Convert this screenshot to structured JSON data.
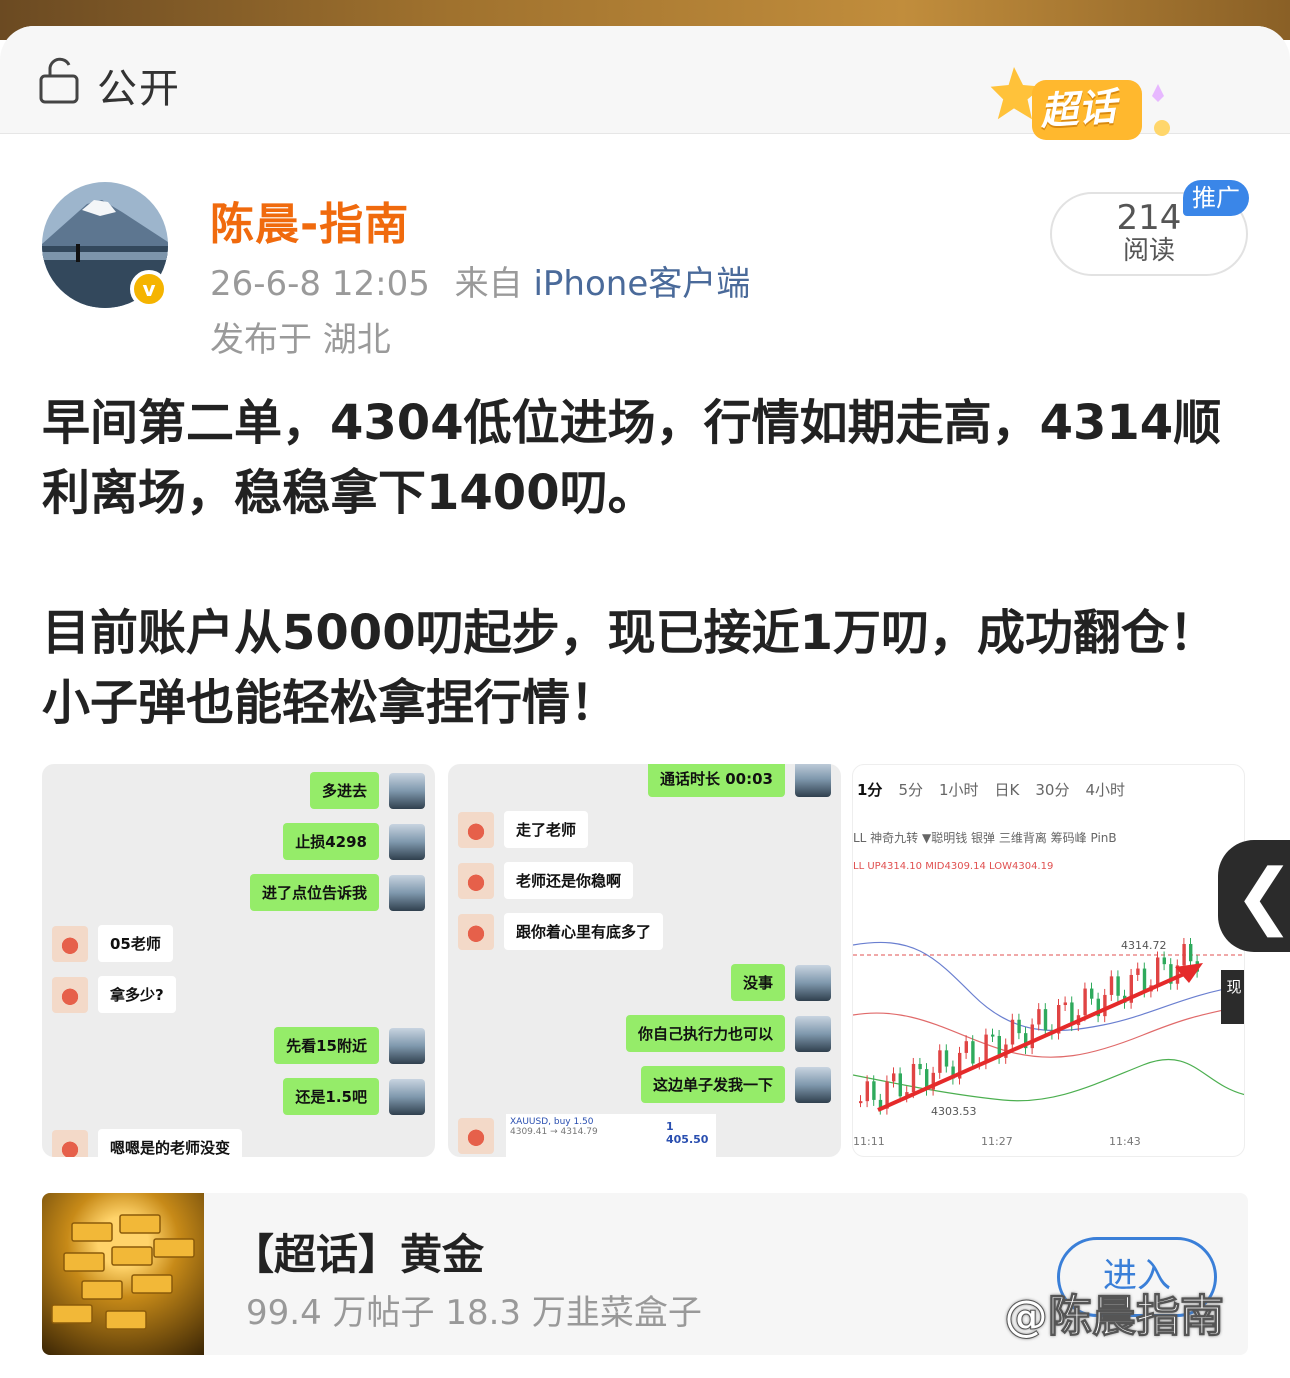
{
  "header": {
    "visibility_icon": "lock-open-icon",
    "visibility_label": "公开",
    "chaohua_badge": "超话"
  },
  "author": {
    "name": "陈晨-指南",
    "verified_icon": "verified-v-icon",
    "verified_mark": "v",
    "time": "26-6-8 12:05",
    "from_label": "来自",
    "source": "iPhone客户端",
    "location": "发布于 湖北"
  },
  "reads": {
    "count": "214",
    "label": "阅读",
    "promo": "推广"
  },
  "post": {
    "para1": "早间第二单，4304低位进场，行情如期走高，4314顺利离场，稳稳拿下1400叨。",
    "para2": "目前账户从5000叨起步，现已接近1万叨，成功翻仓！小子弹也能轻松拿捏行情！"
  },
  "chat1": {
    "messages": [
      {
        "side": "right",
        "text": "多进去"
      },
      {
        "side": "right",
        "text": "止损4298"
      },
      {
        "side": "right",
        "text": "进了点位告诉我"
      },
      {
        "side": "left",
        "text": "05老师"
      },
      {
        "side": "left",
        "text": "拿多少?"
      },
      {
        "side": "right",
        "text": "先看15附近"
      },
      {
        "side": "right",
        "text": "还是1.5吧"
      },
      {
        "side": "left",
        "text": "嗯嗯是的老师没变"
      }
    ]
  },
  "chat2": {
    "messages": [
      {
        "side": "right",
        "text": "通话时长 00:03"
      },
      {
        "side": "left",
        "text": "走了老师"
      },
      {
        "side": "left",
        "text": "老师还是你稳啊"
      },
      {
        "side": "left",
        "text": "跟你着心里有底多了"
      },
      {
        "side": "right",
        "text": "没事"
      },
      {
        "side": "right",
        "text": "你自己执行力也可以"
      },
      {
        "side": "right",
        "text": "这边单子发我一下"
      }
    ],
    "order_symbol": "XAUUSD, buy 1.50",
    "order_prices": "4309.41 → 4314.79",
    "order_profit": "1 405.50"
  },
  "chart": {
    "tabs": [
      "1分",
      "5分",
      "1小时",
      "日K",
      "30分",
      "4小时"
    ],
    "indicators": "LL  神奇九转  ▼聪明钱  银弹  三维背离  筹码峰  PinB",
    "boll": "LL UP4314.10 MID4309.14 LOW4304.19",
    "high_label": "4314.72",
    "low_label": "4303.53",
    "x_times": [
      "11:11",
      "11:27",
      "11:43"
    ],
    "current_label": "现"
  },
  "chart_data": {
    "type": "line",
    "title": "",
    "x": [
      "11:11",
      "11:27",
      "11:43"
    ],
    "series": [
      {
        "values": [
          4304.5,
          4309.5,
          4314.7
        ]
      }
    ],
    "ylim": [
      4303.53,
      4314.72
    ]
  },
  "topic": {
    "title": "【超话】黄金",
    "stats": "99.4 万帖子 18.3 万韭菜盒子",
    "enter_label": "进入"
  },
  "watermark": "@陈晨指南"
}
